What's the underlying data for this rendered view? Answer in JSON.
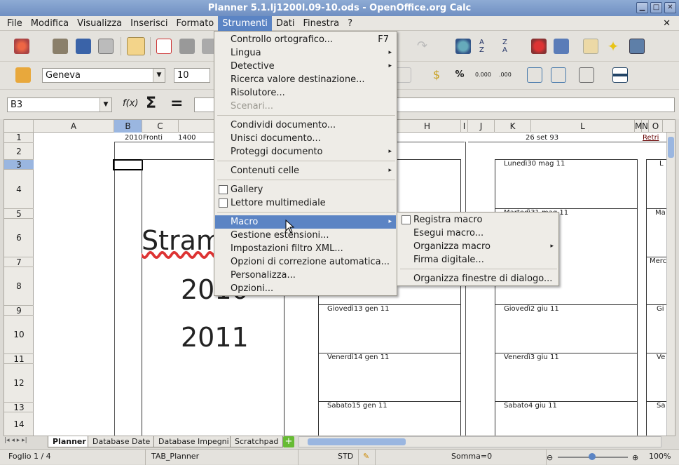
{
  "window": {
    "title": "Planner 5.1.lj1200l.09-10.ods - OpenOffice.org Calc"
  },
  "menubar": {
    "items": [
      "File",
      "Modifica",
      "Visualizza",
      "Inserisci",
      "Formato",
      "Strumenti",
      "Dati",
      "Finestra",
      "?"
    ],
    "active": "Strumenti"
  },
  "font_name": "Geneva",
  "font_size": "10",
  "cell_ref": "B3",
  "formula_symbols": {
    "fx": "f(x)",
    "sum": "Σ",
    "eq": "="
  },
  "format_buttons": {
    "percent": "%",
    "decimal_add": "0.000",
    "decimal_del": ".000"
  },
  "columns": [
    "A",
    "B",
    "C",
    "H",
    "I",
    "J",
    "K",
    "L",
    "M",
    "N",
    "O"
  ],
  "rows": [
    "1",
    "2",
    "3",
    "4",
    "5",
    "6",
    "7",
    "8",
    "9",
    "10",
    "11",
    "12",
    "13",
    "14"
  ],
  "sheet": {
    "row1_left": "2010",
    "row1_fronti": "Fronti",
    "row1_1400": "1400",
    "row1_date": "26 set 93",
    "row1_retri": "Retri",
    "big_title": "Stram",
    "year1": "2010",
    "year2": "2011",
    "col_mid_days": [
      "Giovedì13 gen 11",
      "Venerdì14 gen 11",
      "Sabato15 gen 11"
    ],
    "col_right_days": [
      "Lunedì30 mag 11",
      "Martedì31 mag 11",
      "Giovedì2 giu 11",
      "Venerdì3 giu 11",
      "Sabato4 giu 11"
    ],
    "col_far_days": [
      "L",
      "Ma",
      "Merc",
      "Gi",
      "Ve",
      "Sa"
    ]
  },
  "strumenti_menu": {
    "items": [
      {
        "label": "Controllo ortografico...",
        "shortcut": "F7"
      },
      {
        "label": "Lingua",
        "submenu": true
      },
      {
        "label": "Detective",
        "submenu": true
      },
      {
        "label": "Ricerca valore destinazione..."
      },
      {
        "label": "Risolutore..."
      },
      {
        "label": "Scenari...",
        "disabled": true
      },
      {
        "label": "Condividi documento..."
      },
      {
        "label": "Unisci documento..."
      },
      {
        "label": "Proteggi documento",
        "submenu": true
      },
      {
        "label": "Contenuti celle",
        "submenu": true
      },
      {
        "label": "Gallery",
        "check": true
      },
      {
        "label": "Lettore multimediale",
        "check": true
      },
      {
        "label": "Macro",
        "submenu": true,
        "highlighted": true
      },
      {
        "label": "Gestione estensioni..."
      },
      {
        "label": "Impostazioni filtro XML..."
      },
      {
        "label": "Opzioni di correzione automatica..."
      },
      {
        "label": "Personalizza..."
      },
      {
        "label": "Opzioni..."
      }
    ]
  },
  "macro_submenu": {
    "items": [
      {
        "label": "Registra macro",
        "check": true
      },
      {
        "label": "Esegui macro..."
      },
      {
        "label": "Organizza macro",
        "submenu": true
      },
      {
        "label": "Firma digitale..."
      },
      {
        "label": "Organizza finestre di dialogo..."
      }
    ]
  },
  "sheet_tabs": [
    "Planner",
    "Database Date",
    "Database Impegni",
    "Scratchpad"
  ],
  "status": {
    "sheet": "Foglio 1 / 4",
    "page_style": "TAB_Planner",
    "mode": "STD",
    "sum": "Somma=0",
    "zoom": "100%"
  },
  "colors": {
    "accent": "#5b84c4",
    "title_bar": "#7b97c8"
  }
}
